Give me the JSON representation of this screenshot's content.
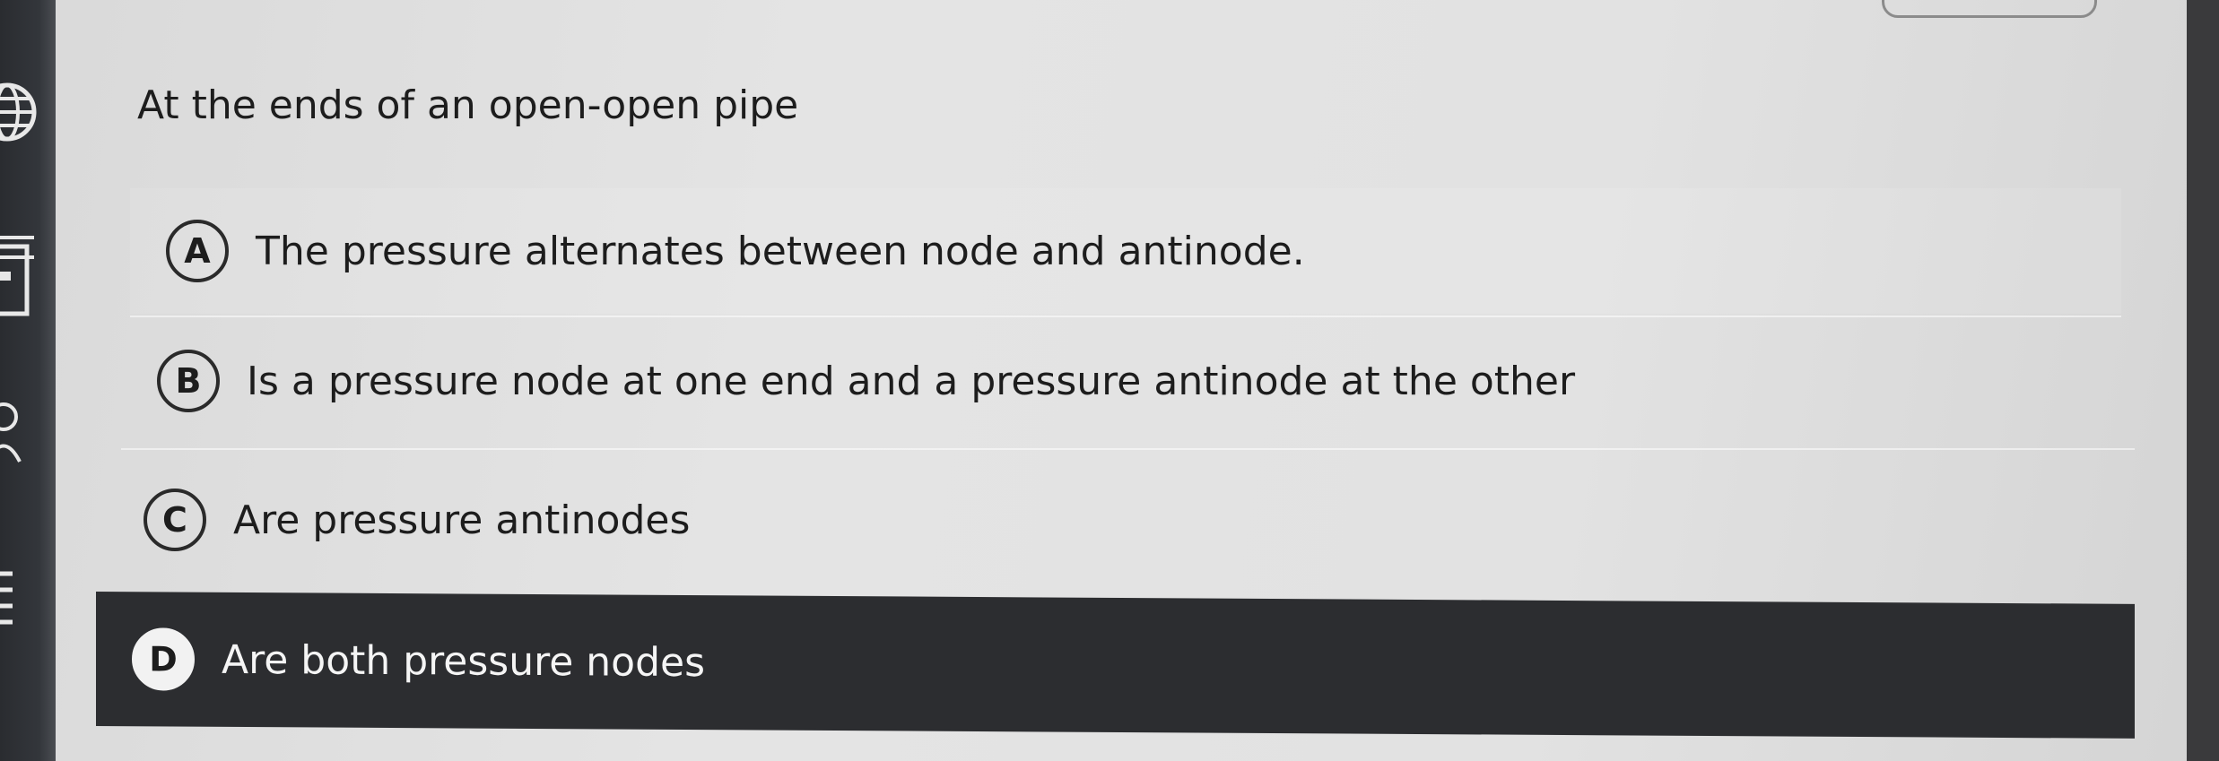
{
  "question": {
    "text": "At the ends of an open-open pipe"
  },
  "options": [
    {
      "letter": "A",
      "text": "The pressure alternates between node and antinode.",
      "selected": false
    },
    {
      "letter": "B",
      "text": "Is a pressure node at one end and a pressure antinode at the other",
      "selected": false
    },
    {
      "letter": "C",
      "text": "Are pressure antinodes",
      "selected": false
    },
    {
      "letter": "D",
      "text": "Are both pressure nodes",
      "selected": true
    }
  ],
  "colors": {
    "selected_background": "#2c2d30",
    "selected_text": "#f5f5f5",
    "text": "#1d1d1d"
  },
  "icons": [
    "globe-icon",
    "document-icon"
  ]
}
